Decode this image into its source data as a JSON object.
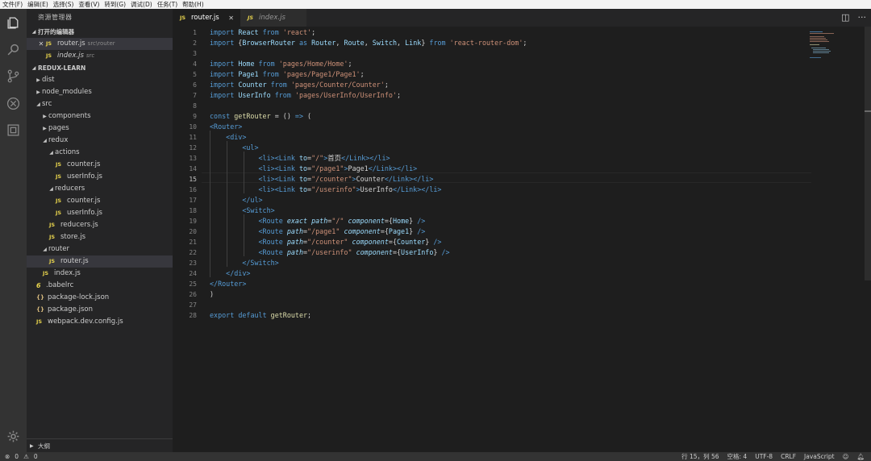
{
  "menu": [
    "文件(F)",
    "编辑(E)",
    "选择(S)",
    "查看(V)",
    "转到(G)",
    "调试(D)",
    "任务(T)",
    "帮助(H)"
  ],
  "sidebar": {
    "title": "资源管理器",
    "open_editors_label": "打开的编辑器",
    "open_editors": [
      {
        "name": "router.js",
        "path": "src\\router"
      },
      {
        "name": "index.js",
        "path": "src"
      }
    ],
    "project_label": "REDUX-LEARN",
    "tree": [
      {
        "name": "dist",
        "depth": 0,
        "kind": "folder",
        "open": false
      },
      {
        "name": "node_modules",
        "depth": 0,
        "kind": "folder",
        "open": false
      },
      {
        "name": "src",
        "depth": 0,
        "kind": "folder",
        "open": true
      },
      {
        "name": "components",
        "depth": 1,
        "kind": "folder",
        "open": false
      },
      {
        "name": "pages",
        "depth": 1,
        "kind": "folder",
        "open": false
      },
      {
        "name": "redux",
        "depth": 1,
        "kind": "folder",
        "open": true
      },
      {
        "name": "actions",
        "depth": 2,
        "kind": "folder",
        "open": true
      },
      {
        "name": "counter.js",
        "depth": 3,
        "kind": "js"
      },
      {
        "name": "userInfo.js",
        "depth": 3,
        "kind": "js"
      },
      {
        "name": "reducers",
        "depth": 2,
        "kind": "folder",
        "open": true
      },
      {
        "name": "counter.js",
        "depth": 3,
        "kind": "js"
      },
      {
        "name": "userInfo.js",
        "depth": 3,
        "kind": "js"
      },
      {
        "name": "reducers.js",
        "depth": 2,
        "kind": "js"
      },
      {
        "name": "store.js",
        "depth": 2,
        "kind": "js"
      },
      {
        "name": "router",
        "depth": 1,
        "kind": "folder",
        "open": true
      },
      {
        "name": "router.js",
        "depth": 2,
        "kind": "js",
        "selected": true
      },
      {
        "name": "index.js",
        "depth": 1,
        "kind": "js"
      },
      {
        "name": ".babelrc",
        "depth": 0,
        "kind": "babel"
      },
      {
        "name": "package-lock.json",
        "depth": 0,
        "kind": "json"
      },
      {
        "name": "package.json",
        "depth": 0,
        "kind": "json"
      },
      {
        "name": "webpack.dev.config.js",
        "depth": 0,
        "kind": "js"
      }
    ],
    "outline_label": "大纲"
  },
  "tabs": [
    {
      "label": "router.js",
      "active": true
    },
    {
      "label": "index.js",
      "active": false
    }
  ],
  "editor": {
    "current_line": 15,
    "lines": [
      [
        [
          "k",
          "import"
        ],
        [
          "p",
          " "
        ],
        [
          "v",
          "React"
        ],
        [
          "p",
          " "
        ],
        [
          "k",
          "from"
        ],
        [
          "p",
          " "
        ],
        [
          "s",
          "'react'"
        ],
        [
          "p",
          ";"
        ]
      ],
      [
        [
          "k",
          "import"
        ],
        [
          "p",
          " {"
        ],
        [
          "v",
          "BrowserRouter"
        ],
        [
          "p",
          " "
        ],
        [
          "k",
          "as"
        ],
        [
          "p",
          " "
        ],
        [
          "v",
          "Router"
        ],
        [
          "p",
          ", "
        ],
        [
          "v",
          "Route"
        ],
        [
          "p",
          ", "
        ],
        [
          "v",
          "Switch"
        ],
        [
          "p",
          ", "
        ],
        [
          "v",
          "Link"
        ],
        [
          "p",
          "} "
        ],
        [
          "k",
          "from"
        ],
        [
          "p",
          " "
        ],
        [
          "s",
          "'react-router-dom'"
        ],
        [
          "p",
          ";"
        ]
      ],
      [],
      [
        [
          "k",
          "import"
        ],
        [
          "p",
          " "
        ],
        [
          "v",
          "Home"
        ],
        [
          "p",
          " "
        ],
        [
          "k",
          "from"
        ],
        [
          "p",
          " "
        ],
        [
          "s",
          "'pages/Home/Home'"
        ],
        [
          "p",
          ";"
        ]
      ],
      [
        [
          "k",
          "import"
        ],
        [
          "p",
          " "
        ],
        [
          "v",
          "Page1"
        ],
        [
          "p",
          " "
        ],
        [
          "k",
          "from"
        ],
        [
          "p",
          " "
        ],
        [
          "s",
          "'pages/Page1/Page1'"
        ],
        [
          "p",
          ";"
        ]
      ],
      [
        [
          "k",
          "import"
        ],
        [
          "p",
          " "
        ],
        [
          "v",
          "Counter"
        ],
        [
          "p",
          " "
        ],
        [
          "k",
          "from"
        ],
        [
          "p",
          " "
        ],
        [
          "s",
          "'pages/Counter/Counter'"
        ],
        [
          "p",
          ";"
        ]
      ],
      [
        [
          "k",
          "import"
        ],
        [
          "p",
          " "
        ],
        [
          "v",
          "UserInfo"
        ],
        [
          "p",
          " "
        ],
        [
          "k",
          "from"
        ],
        [
          "p",
          " "
        ],
        [
          "s",
          "'pages/UserInfo/UserInfo'"
        ],
        [
          "p",
          ";"
        ]
      ],
      [],
      [
        [
          "k",
          "const"
        ],
        [
          "p",
          " "
        ],
        [
          "f",
          "getRouter"
        ],
        [
          "p",
          " = () "
        ],
        [
          "k",
          "=>"
        ],
        [
          "p",
          " ("
        ]
      ],
      [
        [
          "t",
          "<Router>"
        ]
      ],
      [
        [
          "p",
          "    "
        ],
        [
          "t",
          "<div>"
        ]
      ],
      [
        [
          "p",
          "        "
        ],
        [
          "t",
          "<ul>"
        ]
      ],
      [
        [
          "p",
          "            "
        ],
        [
          "t",
          "<li>"
        ],
        [
          "t",
          "<Link"
        ],
        [
          "p",
          " "
        ],
        [
          "v",
          "to"
        ],
        [
          "p",
          "="
        ],
        [
          "s",
          "\"/\""
        ],
        [
          "t",
          ">"
        ],
        [
          "p",
          "首页"
        ],
        [
          "t",
          "</Link>"
        ],
        [
          "t",
          "</li>"
        ]
      ],
      [
        [
          "p",
          "            "
        ],
        [
          "t",
          "<li>"
        ],
        [
          "t",
          "<Link"
        ],
        [
          "p",
          " "
        ],
        [
          "v",
          "to"
        ],
        [
          "p",
          "="
        ],
        [
          "s",
          "\"/page1\""
        ],
        [
          "t",
          ">"
        ],
        [
          "p",
          "Page1"
        ],
        [
          "t",
          "</Link>"
        ],
        [
          "t",
          "</li>"
        ]
      ],
      [
        [
          "p",
          "            "
        ],
        [
          "t",
          "<li>"
        ],
        [
          "t",
          "<Link"
        ],
        [
          "p",
          " "
        ],
        [
          "v",
          "to"
        ],
        [
          "p",
          "="
        ],
        [
          "s",
          "\"/counter\""
        ],
        [
          "t",
          ">"
        ],
        [
          "p",
          "Counter"
        ],
        [
          "t",
          "</Link>"
        ],
        [
          "t",
          "</li>"
        ]
      ],
      [
        [
          "p",
          "            "
        ],
        [
          "t",
          "<li>"
        ],
        [
          "t",
          "<Link"
        ],
        [
          "p",
          " "
        ],
        [
          "v",
          "to"
        ],
        [
          "p",
          "="
        ],
        [
          "s",
          "\"/userinfo\""
        ],
        [
          "t",
          ">"
        ],
        [
          "p",
          "UserInfo"
        ],
        [
          "t",
          "</Link>"
        ],
        [
          "t",
          "</li>"
        ]
      ],
      [
        [
          "p",
          "        "
        ],
        [
          "t",
          "</ul>"
        ]
      ],
      [
        [
          "p",
          "        "
        ],
        [
          "t",
          "<Switch>"
        ]
      ],
      [
        [
          "p",
          "            "
        ],
        [
          "t",
          "<Route"
        ],
        [
          "p",
          " "
        ],
        [
          "a",
          "exact"
        ],
        [
          "p",
          " "
        ],
        [
          "a",
          "path"
        ],
        [
          "p",
          "="
        ],
        [
          "s",
          "\"/\""
        ],
        [
          "p",
          " "
        ],
        [
          "a",
          "component"
        ],
        [
          "p",
          "={"
        ],
        [
          "v",
          "Home"
        ],
        [
          "p",
          "} "
        ],
        [
          "t",
          "/>"
        ]
      ],
      [
        [
          "p",
          "            "
        ],
        [
          "t",
          "<Route"
        ],
        [
          "p",
          " "
        ],
        [
          "a",
          "path"
        ],
        [
          "p",
          "="
        ],
        [
          "s",
          "\"/page1\""
        ],
        [
          "p",
          " "
        ],
        [
          "a",
          "component"
        ],
        [
          "p",
          "={"
        ],
        [
          "v",
          "Page1"
        ],
        [
          "p",
          "} "
        ],
        [
          "t",
          "/>"
        ]
      ],
      [
        [
          "p",
          "            "
        ],
        [
          "t",
          "<Route"
        ],
        [
          "p",
          " "
        ],
        [
          "a",
          "path"
        ],
        [
          "p",
          "="
        ],
        [
          "s",
          "\"/counter\""
        ],
        [
          "p",
          " "
        ],
        [
          "a",
          "component"
        ],
        [
          "p",
          "={"
        ],
        [
          "v",
          "Counter"
        ],
        [
          "p",
          "} "
        ],
        [
          "t",
          "/>"
        ]
      ],
      [
        [
          "p",
          "            "
        ],
        [
          "t",
          "<Route"
        ],
        [
          "p",
          " "
        ],
        [
          "a",
          "path"
        ],
        [
          "p",
          "="
        ],
        [
          "s",
          "\"/userinfo\""
        ],
        [
          "p",
          " "
        ],
        [
          "a",
          "component"
        ],
        [
          "p",
          "={"
        ],
        [
          "v",
          "UserInfo"
        ],
        [
          "p",
          "} "
        ],
        [
          "t",
          "/>"
        ]
      ],
      [
        [
          "p",
          "        "
        ],
        [
          "t",
          "</Switch>"
        ]
      ],
      [
        [
          "p",
          "    "
        ],
        [
          "t",
          "</div>"
        ]
      ],
      [
        [
          "t",
          "</Router>"
        ]
      ],
      [
        [
          "p",
          ")"
        ]
      ],
      [],
      [
        [
          "k",
          "export"
        ],
        [
          "p",
          " "
        ],
        [
          "k",
          "default"
        ],
        [
          "p",
          " "
        ],
        [
          "f",
          "getRouter"
        ],
        [
          "p",
          ";"
        ]
      ]
    ]
  },
  "status": {
    "errors": "0",
    "warnings": "0",
    "position": "行 15，列 56",
    "spaces": "空格: 4",
    "encoding": "UTF-8",
    "eol": "CRLF",
    "language": "JavaScript"
  }
}
